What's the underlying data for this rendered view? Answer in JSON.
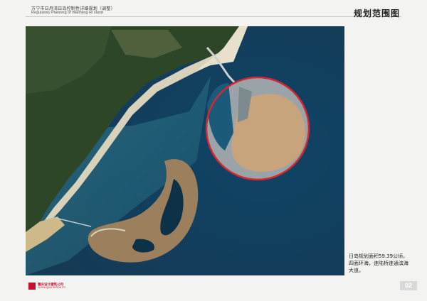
{
  "header": {
    "title_zh": "万宁市日月湾日岛控制性详细规划（调整）",
    "title_en": "Regulatory Planning of WanNing Ri sland"
  },
  "page_title": "规划范围图",
  "caption": {
    "line1": "日岛规划面积59.39公顷，",
    "line2": "四面环海，连陆桥连通滨海",
    "line3": "大道。"
  },
  "footer": {
    "logo_cn": "重庆设计建筑公司",
    "logo_en": "CHONGQING DESIGN CO.",
    "page_number": "02"
  },
  "colors": {
    "boundary": "#d7262e",
    "sea": "#123f5e",
    "land": "#2f4a2a"
  }
}
